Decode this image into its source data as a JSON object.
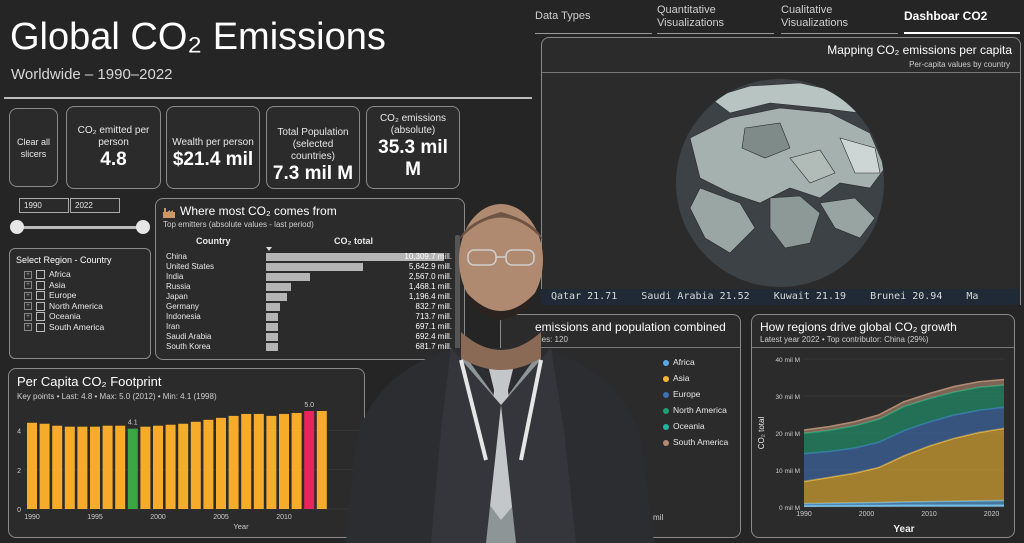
{
  "header": {
    "title": "Global CO₂ Emissions",
    "subtitle": "Worldwide – 1990–2022"
  },
  "nav": {
    "tabs": [
      {
        "label": "Data Types",
        "active": false
      },
      {
        "label": "Quantitative\nVisualizations",
        "active": false
      },
      {
        "label": "Cualitative\nVisualizations",
        "active": false
      },
      {
        "label": "Dashboar CO2",
        "active": true
      }
    ]
  },
  "kpis": {
    "clear_label": "Clear all slicers",
    "per_person_label": "CO₂ emitted per person",
    "per_person_value": "4.8",
    "wealth_label": "Wealth per person",
    "wealth_value": "$21.4 mil",
    "population_label": "Total Population (selected countries)",
    "population_value": "7.3 mil M",
    "absolute_label": "CO₂ emissions (absolute)",
    "absolute_value": "35.3 mil M"
  },
  "year_slicer": {
    "start": "1990",
    "end": "2022"
  },
  "region_slicer": {
    "title": "Select Region - Country",
    "items": [
      "Africa",
      "Asia",
      "Europe",
      "North America",
      "Oceania",
      "South America"
    ]
  },
  "emitters": {
    "title": "Where most CO₂ comes from",
    "subtitle": "Top emitters (absolute values - last period)",
    "col_country": "Country",
    "col_total": "CO₂ total",
    "rows": [
      {
        "country": "China",
        "value": "10,309.7 mill.",
        "num": 10309.7
      },
      {
        "country": "United States",
        "value": "5,642.9 mill.",
        "num": 5642.9
      },
      {
        "country": "India",
        "value": "2,567.0 mill.",
        "num": 2567.0
      },
      {
        "country": "Russia",
        "value": "1,468.1 mill.",
        "num": 1468.1
      },
      {
        "country": "Japan",
        "value": "1,196.4 mill.",
        "num": 1196.4
      },
      {
        "country": "Germany",
        "value": "832.7 mill.",
        "num": 832.7
      },
      {
        "country": "Indonesia",
        "value": "713.7 mill.",
        "num": 713.7
      },
      {
        "country": "Iran",
        "value": "697.1 mill.",
        "num": 697.1
      },
      {
        "country": "Saudi Arabia",
        "value": "692.4 mill.",
        "num": 692.4
      },
      {
        "country": "South Korea",
        "value": "681.7 mill.",
        "num": 681.7
      }
    ]
  },
  "map": {
    "title": "Mapping CO₂ emissions per capita",
    "subtitle": "Per-capita values by country",
    "ticker": "Qatar 21.71    Saudi Arabia 21.52    Kuwait 21.19    Brunei 20.94    Ma"
  },
  "scatter_panel": {
    "title": "emissions and population combined",
    "subtitle": "tries: 120",
    "axis_fragment": "mil",
    "legend": [
      {
        "name": "Africa",
        "color": "#5aa9e6"
      },
      {
        "name": "Asia",
        "color": "#f2b632"
      },
      {
        "name": "Europe",
        "color": "#3f6fb5"
      },
      {
        "name": "North America",
        "color": "#1e9e73"
      },
      {
        "name": "Oceania",
        "color": "#21b5a0"
      },
      {
        "name": "South America",
        "color": "#b08a72"
      }
    ]
  },
  "colors": {
    "bar": "#f7ab2b",
    "bar_min": "#3aa644",
    "bar_max": "#e8245c",
    "panel_border": "#8a8a8a"
  },
  "chart_data": [
    {
      "type": "bar",
      "title": "Per Capita CO₂ Footprint",
      "subtitle": "Key points • Last: 4.8 • Max: 5.0 (2012) • Min: 4.1 (1998)",
      "xlabel": "Year",
      "ylabel": "",
      "ylim": [
        0,
        5
      ],
      "y_ticks": [
        0,
        2,
        4
      ],
      "x_ticks": [
        "1990",
        "1995",
        "2000",
        "2005",
        "2010"
      ],
      "annotations": [
        {
          "label": "4.1",
          "x": 1998
        },
        {
          "label": "5.0",
          "x": 2012
        }
      ],
      "x": [
        1990,
        1991,
        1992,
        1993,
        1994,
        1995,
        1996,
        1997,
        1998,
        1999,
        2000,
        2001,
        2002,
        2003,
        2004,
        2005,
        2006,
        2007,
        2008,
        2009,
        2010,
        2011,
        2012,
        2013
      ],
      "values": [
        4.4,
        4.35,
        4.25,
        4.2,
        4.2,
        4.2,
        4.25,
        4.25,
        4.1,
        4.2,
        4.25,
        4.3,
        4.35,
        4.45,
        4.55,
        4.65,
        4.75,
        4.85,
        4.85,
        4.75,
        4.85,
        4.9,
        5.0,
        5.0
      ],
      "highlight": {
        "min_x": 1998,
        "max_x": 2012
      }
    },
    {
      "type": "area",
      "title": "How regions drive global CO₂ growth",
      "subtitle": "Latest year 2022 • Top contributor: China (29%)",
      "xlabel": "Year",
      "ylabel": "CO₂ total",
      "xlim": [
        1990,
        2022
      ],
      "ylim": [
        0,
        40
      ],
      "y_ticks": [
        {
          "v": 0,
          "label": "0 mil M"
        },
        {
          "v": 10,
          "label": "10 mil M"
        },
        {
          "v": 20,
          "label": "20 mil M"
        },
        {
          "v": 30,
          "label": "30 mil M"
        },
        {
          "v": 40,
          "label": "40 mil M"
        }
      ],
      "x_ticks": [
        "1990",
        "2000",
        "2010",
        "2020"
      ],
      "x": [
        1990,
        1994,
        1998,
        2002,
        2006,
        2010,
        2014,
        2018,
        2022
      ],
      "series": [
        {
          "key": "oceania",
          "values": [
            0.3,
            0.35,
            0.4,
            0.4,
            0.45,
            0.45,
            0.45,
            0.45,
            0.45
          ],
          "color": "#7fc6e8"
        },
        {
          "key": "africa",
          "values": [
            0.6,
            0.65,
            0.7,
            0.8,
            0.9,
            1.0,
            1.1,
            1.2,
            1.3
          ],
          "color": "#5aa9e6"
        },
        {
          "key": "asia",
          "values": [
            6.0,
            7.0,
            8.0,
            9.5,
            12.5,
            15.0,
            17.0,
            18.5,
            19.5
          ],
          "color": "#f2b632"
        },
        {
          "key": "europe",
          "values": [
            7.5,
            7.0,
            6.8,
            6.8,
            6.8,
            6.5,
            6.3,
            6.0,
            5.7
          ],
          "color": "#3f6fb5"
        },
        {
          "key": "north_america",
          "values": [
            5.5,
            5.7,
            6.0,
            6.2,
            6.5,
            6.3,
            6.2,
            6.2,
            6.0
          ],
          "color": "#1e9e73"
        },
        {
          "key": "south_america",
          "values": [
            0.9,
            1.0,
            1.1,
            1.2,
            1.3,
            1.4,
            1.5,
            1.5,
            1.5
          ],
          "color": "#b08a72"
        }
      ]
    }
  ]
}
